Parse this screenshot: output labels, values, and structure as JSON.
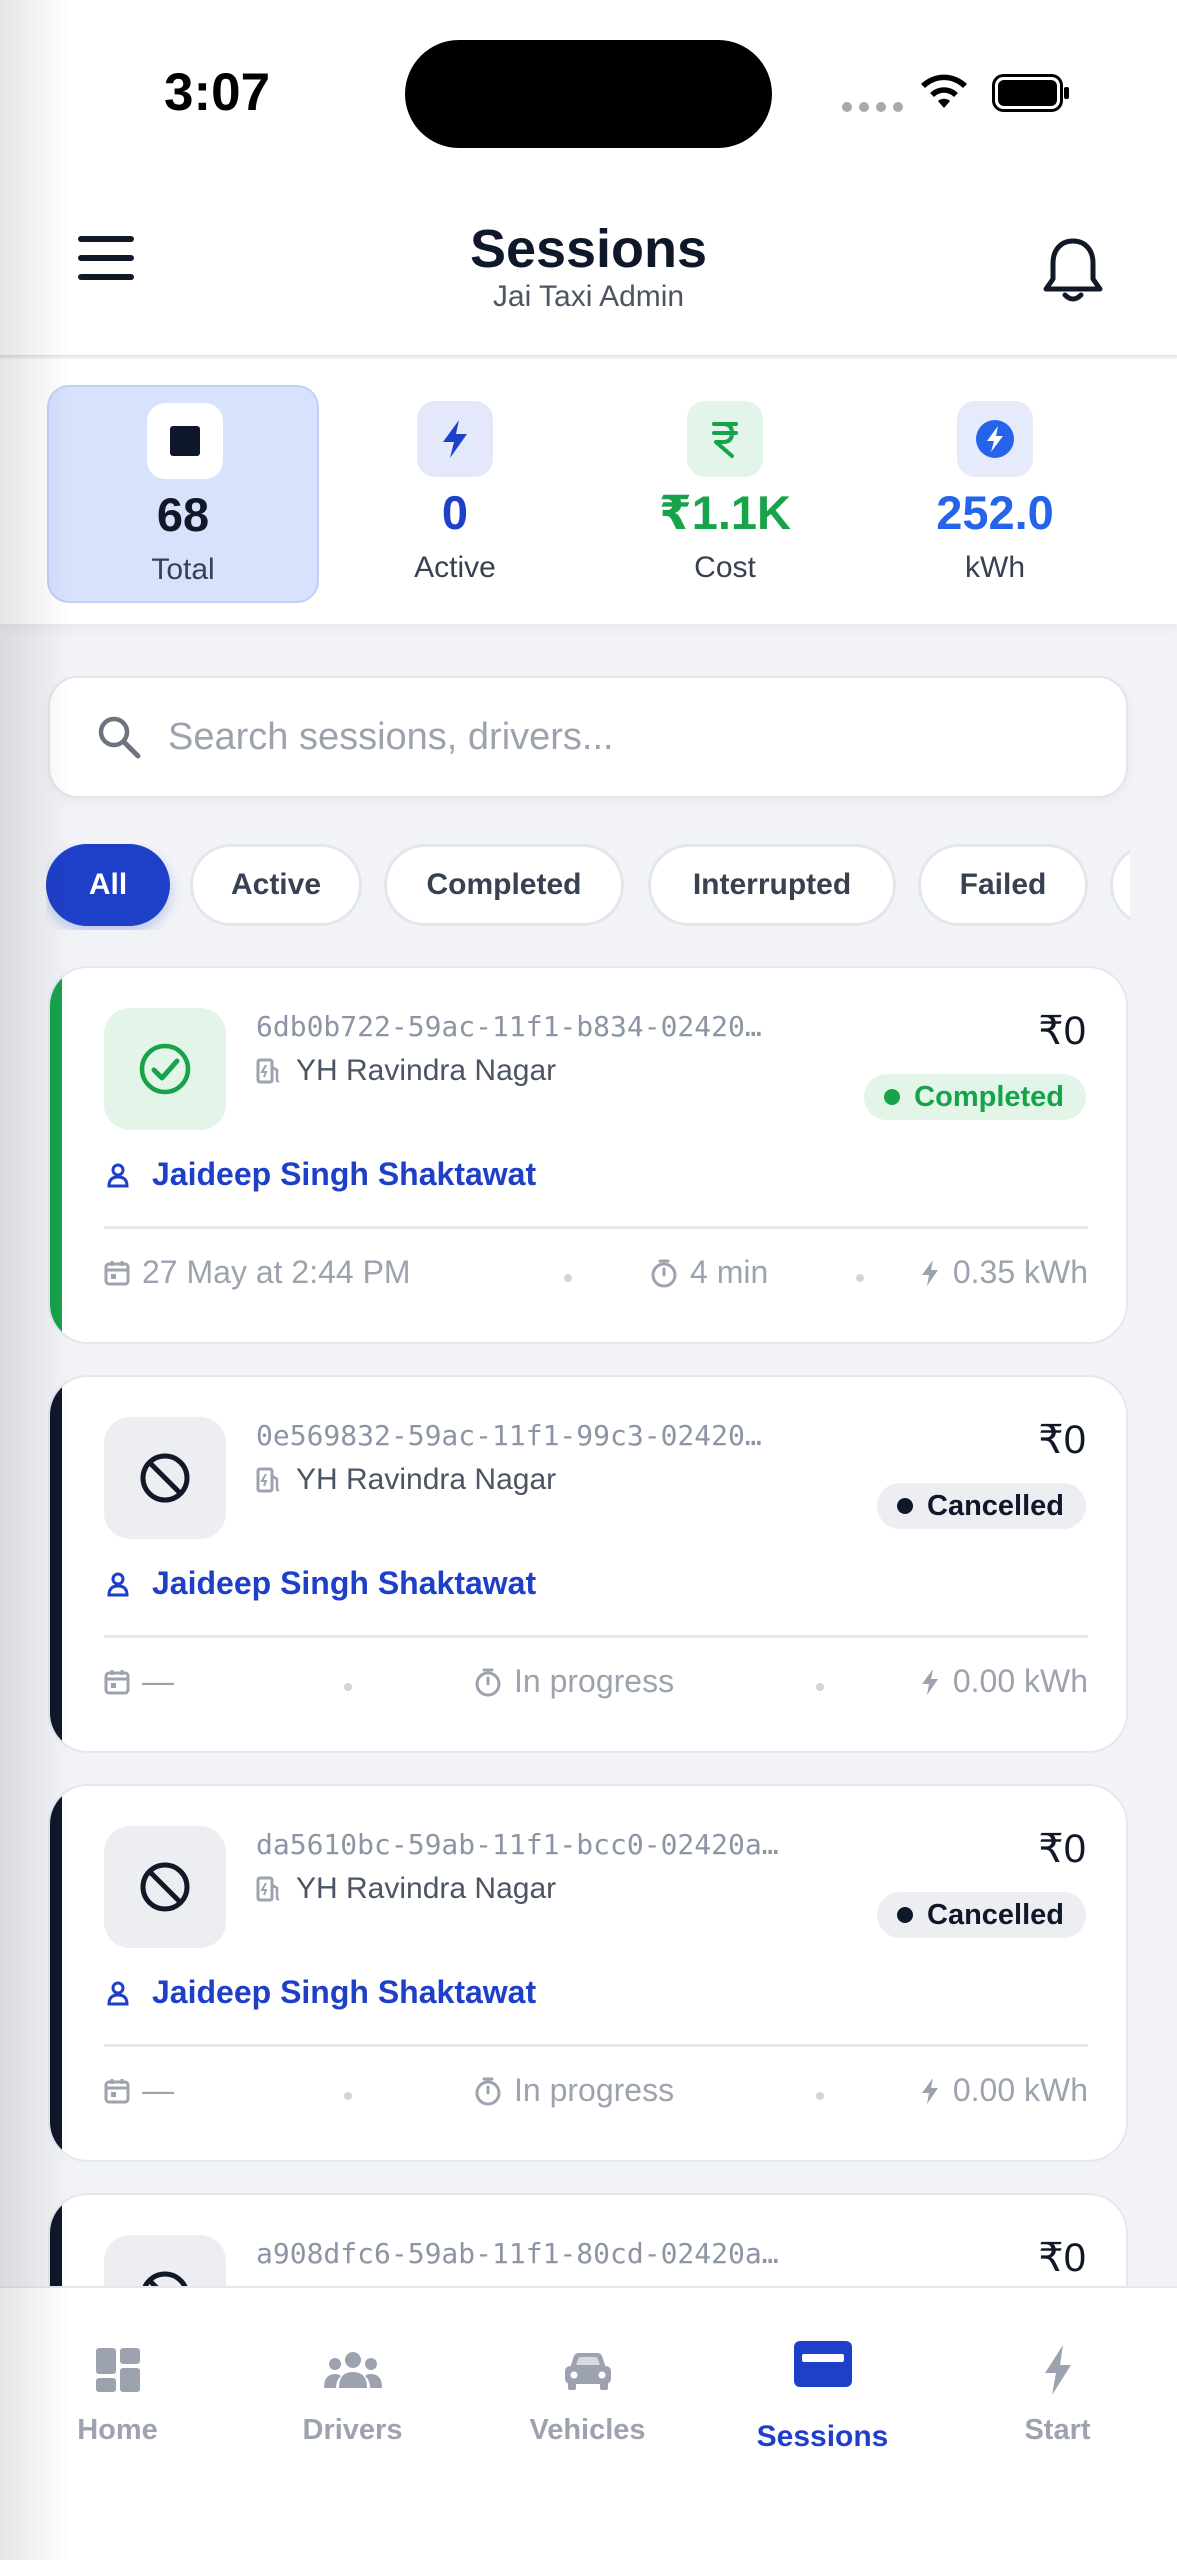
{
  "status_bar": {
    "time": "3:07"
  },
  "header": {
    "title": "Sessions",
    "subtitle": "Jai Taxi Admin"
  },
  "stats": [
    {
      "value": "68",
      "label": "Total",
      "icon": "stop-square-icon",
      "value_color": "#111827"
    },
    {
      "value": "0",
      "label": "Active",
      "icon": "bolt-icon",
      "value_color": "#1e40c8"
    },
    {
      "value": "₹1.1K",
      "label": "Cost",
      "icon": "rupee-icon",
      "value_color": "#16a34a"
    },
    {
      "value": "252.0",
      "label": "kWh",
      "icon": "energy-bolt-icon",
      "value_color": "#2563eb"
    }
  ],
  "search": {
    "placeholder": "Search sessions, drivers..."
  },
  "filters": [
    {
      "label": "All",
      "active": true
    },
    {
      "label": "Active",
      "active": false
    },
    {
      "label": "Completed",
      "active": false
    },
    {
      "label": "Interrupted",
      "active": false
    },
    {
      "label": "Failed",
      "active": false
    }
  ],
  "sessions": [
    {
      "id": "6db0b722-59ac-11f1-b834-02420…",
      "station": "YH Ravindra Nagar",
      "amount": "₹0",
      "status": "Completed",
      "driver": "Jaideep Singh Shaktawat",
      "date": "27 May at 2:44 PM",
      "duration": "4 min",
      "energy": "0.35 kWh"
    },
    {
      "id": "0e569832-59ac-11f1-99c3-02420…",
      "station": "YH Ravindra Nagar",
      "amount": "₹0",
      "status": "Cancelled",
      "driver": "Jaideep Singh Shaktawat",
      "date": "—",
      "duration": "In progress",
      "energy": "0.00 kWh"
    },
    {
      "id": "da5610bc-59ab-11f1-bcc0-02420a…",
      "station": "YH Ravindra Nagar",
      "amount": "₹0",
      "status": "Cancelled",
      "driver": "Jaideep Singh Shaktawat",
      "date": "—",
      "duration": "In progress",
      "energy": "0.00 kWh"
    },
    {
      "id": "a908dfc6-59ab-11f1-80cd-02420a…",
      "amount": "₹0"
    }
  ],
  "nav": [
    {
      "label": "Home",
      "icon": "dashboard-icon",
      "active": false
    },
    {
      "label": "Drivers",
      "icon": "people-icon",
      "active": false
    },
    {
      "label": "Vehicles",
      "icon": "car-icon",
      "active": false
    },
    {
      "label": "Sessions",
      "icon": "card-icon",
      "active": true
    },
    {
      "label": "Start",
      "icon": "bolt-icon",
      "active": false
    }
  ],
  "colors": {
    "primary": "#1e40c8",
    "completed": "#16a34a",
    "completed_bg": "#e3f5e8",
    "cancelled": "#0f172a",
    "cancelled_bg": "#eceef1"
  }
}
